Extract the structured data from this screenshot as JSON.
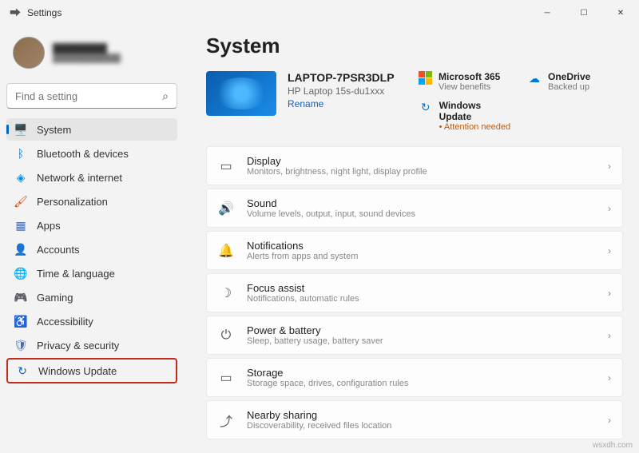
{
  "titlebar": {
    "title": "Settings"
  },
  "user": {
    "name": "████████",
    "email": "████████████"
  },
  "search": {
    "placeholder": "Find a setting"
  },
  "nav": [
    {
      "label": "System",
      "icon": "🖥️",
      "color": "#0067c0",
      "active": true
    },
    {
      "label": "Bluetooth & devices",
      "icon": "ᛒ",
      "color": "#0067c0"
    },
    {
      "label": "Network & internet",
      "icon": "◈",
      "color": "#0091ea"
    },
    {
      "label": "Personalization",
      "icon": "🖌",
      "color": "#d83b01"
    },
    {
      "label": "Apps",
      "icon": "▦",
      "color": "#4a6da7"
    },
    {
      "label": "Accounts",
      "icon": "👤",
      "color": "#666"
    },
    {
      "label": "Time & language",
      "icon": "🌐",
      "color": "#0078d4"
    },
    {
      "label": "Gaming",
      "icon": "🎮",
      "color": "#107c10"
    },
    {
      "label": "Accessibility",
      "icon": "♿",
      "color": "#0067c0"
    },
    {
      "label": "Privacy & security",
      "icon": "🛡",
      "color": "#4a6da7"
    },
    {
      "label": "Windows Update",
      "icon": "↻",
      "color": "#0067c0",
      "highlighted": true
    }
  ],
  "page": {
    "title": "System"
  },
  "device": {
    "name": "LAPTOP-7PSR3DLP",
    "model": "HP Laptop 15s-du1xxx",
    "rename": "Rename"
  },
  "promos": [
    {
      "title": "Microsoft 365",
      "sub": "View benefits",
      "icon": "ms"
    },
    {
      "title": "OneDrive",
      "sub": "Backed up",
      "icon": "☁",
      "color": "#0078d4"
    },
    {
      "title": "Windows Update",
      "sub": "Attention needed",
      "icon": "↻",
      "color": "#0078d4",
      "attention": true
    }
  ],
  "settings": [
    {
      "title": "Display",
      "sub": "Monitors, brightness, night light, display profile",
      "icon": "▭"
    },
    {
      "title": "Sound",
      "sub": "Volume levels, output, input, sound devices",
      "icon": "🔊"
    },
    {
      "title": "Notifications",
      "sub": "Alerts from apps and system",
      "icon": "🔔"
    },
    {
      "title": "Focus assist",
      "sub": "Notifications, automatic rules",
      "icon": "☽"
    },
    {
      "title": "Power & battery",
      "sub": "Sleep, battery usage, battery saver",
      "icon": "⏻"
    },
    {
      "title": "Storage",
      "sub": "Storage space, drives, configuration rules",
      "icon": "▭"
    },
    {
      "title": "Nearby sharing",
      "sub": "Discoverability, received files location",
      "icon": "⤴"
    }
  ],
  "watermark": "wsxdh.com"
}
